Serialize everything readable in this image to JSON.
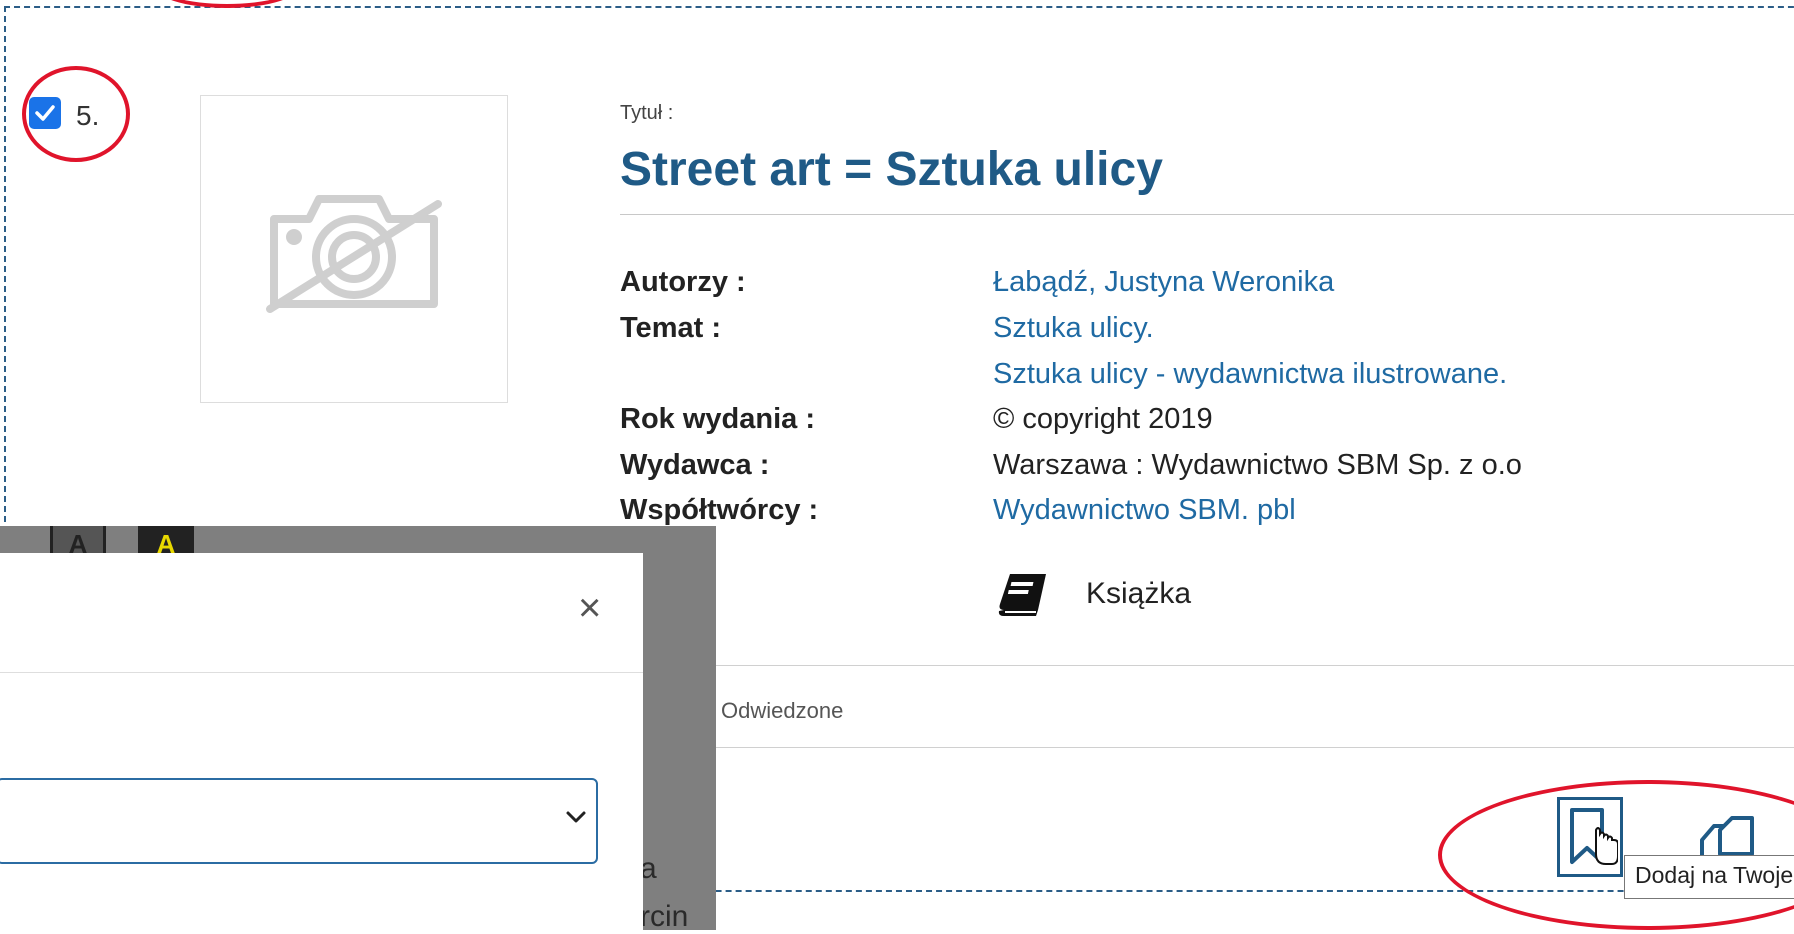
{
  "record": {
    "number": "5.",
    "title_label": "Tytuł :",
    "title": "Street art = Sztuka ulicy",
    "fields": [
      {
        "label": "Autorzy :",
        "values": [
          {
            "text": "Łabądź, Justyna Weronika",
            "link": true
          }
        ]
      },
      {
        "label": "Temat :",
        "values": [
          {
            "text": "Sztuka ulicy.",
            "link": true
          },
          {
            "text": "Sztuka ulicy - wydawnictwa ilustrowane.",
            "link": true
          }
        ]
      },
      {
        "label": "Rok wydania :",
        "values": [
          {
            "text": "© copyright 2019",
            "link": false
          }
        ]
      },
      {
        "label": "Wydawca :",
        "values": [
          {
            "text": "Warszawa : Wydawnictwo SBM Sp. z o.o",
            "link": false
          }
        ]
      },
      {
        "label": "Współtwórcy :",
        "values": [
          {
            "text": "Wydawnictwo SBM. pbl",
            "link": true
          }
        ]
      }
    ],
    "type_label": "Książka",
    "visited_label": "Odwiedzone",
    "tooltip": "Dodaj na Twoje"
  },
  "contrast": {
    "a1": "A",
    "a2": "A"
  },
  "underlay": {
    "line1": "a",
    "line2": "rcin"
  },
  "modal": {
    "close": "×"
  },
  "colors": {
    "accent": "#1f5a86",
    "link": "#1f6aa3",
    "checkbox": "#1a73e8",
    "highlight": "#e0142b"
  },
  "icons": [
    "checkmark-icon",
    "no-image-camera-icon",
    "book-icon",
    "bookmark-icon",
    "hand-cursor-icon",
    "copy-icon",
    "chevron-down-icon",
    "close-icon"
  ]
}
